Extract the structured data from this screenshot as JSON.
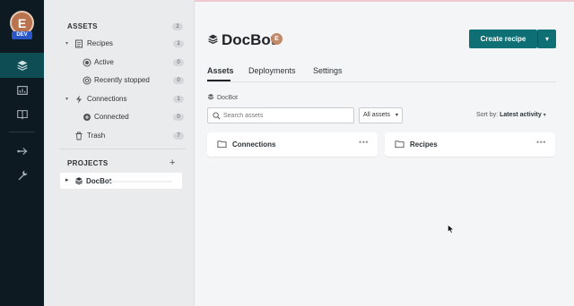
{
  "rail": {
    "avatar_letter": "E",
    "env_badge": "DEV",
    "items": [
      {
        "icon": "layers-icon",
        "active": true
      },
      {
        "icon": "dashboard-icon",
        "active": false
      },
      {
        "icon": "book-icon",
        "active": false
      },
      {
        "icon": "workflow-icon",
        "active": false
      },
      {
        "icon": "wrench-icon",
        "active": false
      }
    ]
  },
  "sidebar": {
    "assets_title": "ASSETS",
    "assets_count": "2",
    "recipes": {
      "label": "Recipes",
      "count": "1"
    },
    "active": {
      "label": "Active",
      "count": "0"
    },
    "recently_stopped": {
      "label": "Recently stopped",
      "count": "0"
    },
    "connections": {
      "label": "Connections",
      "count": "1"
    },
    "connected": {
      "label": "Connected",
      "count": "0"
    },
    "trash": {
      "label": "Trash",
      "count": "7"
    },
    "projects_title": "PROJECTS",
    "add_symbol": "+",
    "project": {
      "label": "DocBot"
    }
  },
  "header": {
    "title": "DocBot",
    "env_letter": "E",
    "create_label": "Create recipe"
  },
  "tabs": [
    "Assets",
    "Deployments",
    "Settings"
  ],
  "breadcrumb": "DocBot",
  "search": {
    "placeholder": "Search assets"
  },
  "filter": {
    "value": "All assets"
  },
  "sort": {
    "prefix": "Sort by:",
    "value": "Latest activity"
  },
  "cards": [
    {
      "label": "Connections"
    },
    {
      "label": "Recipes"
    }
  ],
  "colors": {
    "accent": "#0e6f74",
    "rail_bg": "#0e1a21",
    "rail_active": "#0f4d55"
  }
}
